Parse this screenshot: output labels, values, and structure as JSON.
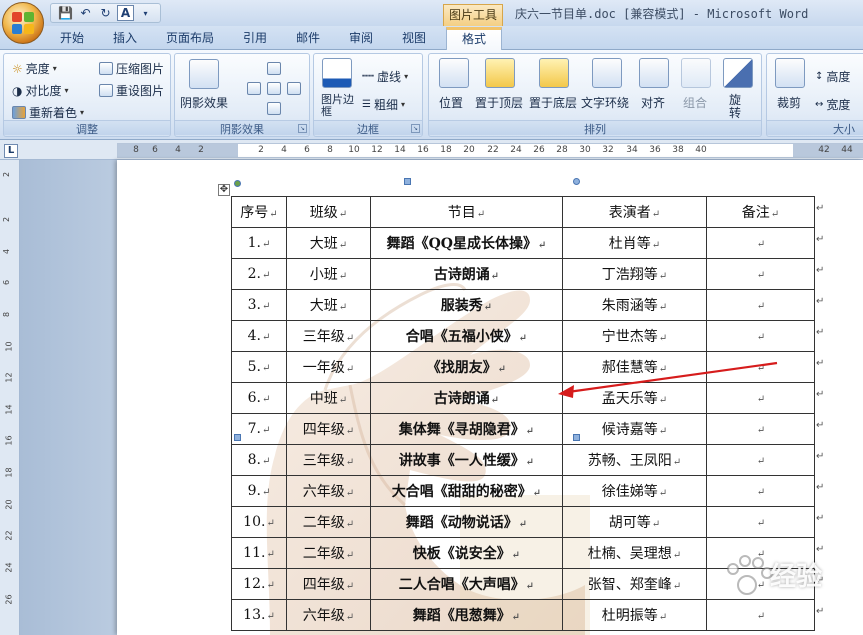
{
  "window": {
    "title": "庆六一节目单.doc [兼容模式] - Microsoft Word",
    "context_tab_group": "图片工具"
  },
  "qat": {
    "save": "💾",
    "undo": "↶",
    "redo": "↻",
    "format": "A"
  },
  "tabs": [
    "开始",
    "插入",
    "页面布局",
    "引用",
    "邮件",
    "审阅",
    "视图"
  ],
  "active_tab": "格式",
  "ribbon": {
    "adjust": {
      "label": "调整",
      "brightness": "亮度",
      "contrast": "对比度",
      "recolor": "重新着色",
      "compress": "压缩图片",
      "reset": "重设图片"
    },
    "shadow": {
      "label": "阴影效果",
      "shadow_effects": "阴影效果"
    },
    "border": {
      "label": "边框",
      "picture_border": "图片边框",
      "dashes": "虚线",
      "weight": "粗细"
    },
    "arrange": {
      "label": "排列",
      "position": "位置",
      "bring_front": "置于顶层",
      "send_back": "置于底层",
      "text_wrap": "文字环绕",
      "align": "对齐",
      "group": "组合",
      "rotate": "旋转"
    },
    "size": {
      "label": "大小",
      "crop": "裁剪",
      "height": "高度",
      "width": "宽度"
    }
  },
  "ruler": {
    "ticks": [
      "8",
      "6",
      "4",
      "2",
      "2",
      "4",
      "6",
      "8",
      "10",
      "12",
      "14",
      "16",
      "18",
      "20",
      "22",
      "24",
      "26",
      "28",
      "30",
      "32",
      "34",
      "36",
      "38",
      "40",
      "42",
      "44"
    ]
  },
  "vruler": {
    "ticks": [
      "2",
      "2",
      "4",
      "6",
      "8",
      "10",
      "12",
      "14",
      "16",
      "18",
      "20",
      "22",
      "24",
      "26"
    ]
  },
  "table": {
    "header": [
      "序号",
      "班级",
      "节目",
      "表演者",
      "备注"
    ],
    "rows": [
      [
        "1.",
        "大班",
        "舞蹈《QQ星成长体操》",
        "杜肖等",
        ""
      ],
      [
        "2.",
        "小班",
        "古诗朗诵",
        "丁浩翔等",
        ""
      ],
      [
        "3.",
        "大班",
        "服装秀",
        "朱雨涵等",
        ""
      ],
      [
        "4.",
        "三年级",
        "合唱《五福小侠》",
        "宁世杰等",
        ""
      ],
      [
        "5.",
        "一年级",
        "《找朋友》",
        "郝佳慧等",
        ""
      ],
      [
        "6.",
        "中班",
        "古诗朗诵",
        "孟天乐等",
        ""
      ],
      [
        "7.",
        "四年级",
        "集体舞《寻胡隐君》",
        "候诗嘉等",
        ""
      ],
      [
        "8.",
        "三年级",
        "讲故事《一人性缓》",
        "苏畅、王凤阳",
        ""
      ],
      [
        "9.",
        "六年级",
        "大合唱《甜甜的秘密》",
        "徐佳娣等",
        ""
      ],
      [
        "10.",
        "二年级",
        "舞蹈《动物说话》",
        "胡可等",
        ""
      ],
      [
        "11.",
        "二年级",
        "快板《说安全》",
        "杜楠、吴理想",
        ""
      ],
      [
        "12.",
        "四年级",
        "二人合唱《大声唱》",
        "张智、郑奎峰",
        ""
      ],
      [
        "13.",
        "六年级",
        "舞蹈《甩葱舞》",
        "杜明振等",
        ""
      ]
    ]
  },
  "watermark": {
    "text": "经验"
  },
  "colors": {
    "ribbon_accent": "#f2c36a",
    "arrow": "#d61c1c",
    "page_bg": "#ffffff"
  }
}
